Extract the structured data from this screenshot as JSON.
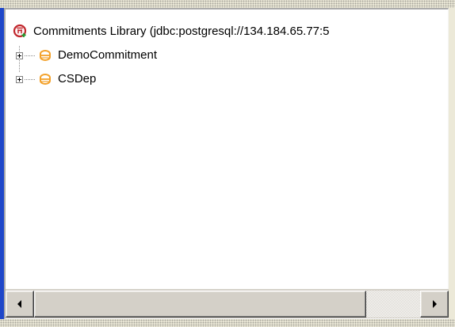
{
  "tree": {
    "root": {
      "label": "Commitments Library (jdbc:postgresql://134.184.65.77:5",
      "icon": "commitments-library-icon"
    },
    "items": [
      {
        "label": "DemoCommitment",
        "icon": "database-icon",
        "expander_state": "collapsed"
      },
      {
        "label": "CSDep",
        "icon": "database-icon",
        "expander_state": "collapsed"
      }
    ]
  },
  "scrollbar": {
    "orientation": "horizontal",
    "thumb_start_fraction": 0,
    "thumb_end_fraction": 0.86
  },
  "colors": {
    "left_accent": "#1f47c9",
    "root_icon_red": "#c1272d",
    "root_icon_green": "#1a9b2d",
    "database_icon_orange": "#f3a12a"
  }
}
